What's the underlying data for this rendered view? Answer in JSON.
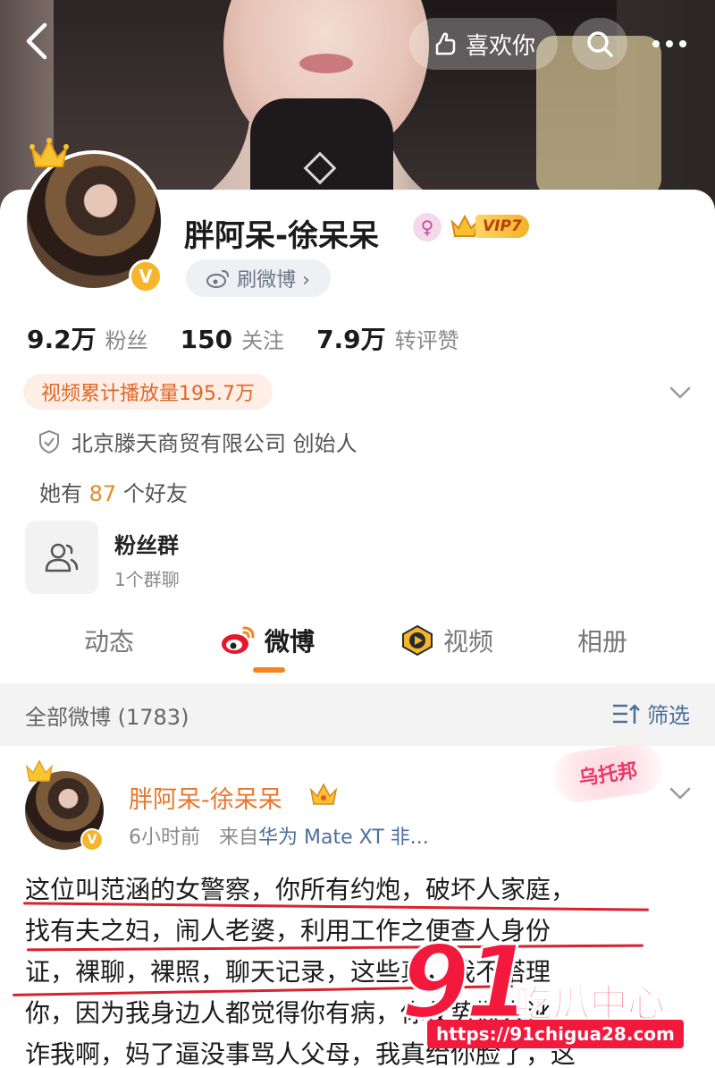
{
  "header": {
    "like_label": "喜欢你"
  },
  "profile": {
    "name": "胖阿呆-徐呆呆",
    "vip_label": "VIP7",
    "weibo_pill_label": "刷微博 ›",
    "stats": [
      {
        "num": "9.2万",
        "label": "粉丝"
      },
      {
        "num": "150",
        "label": "关注"
      },
      {
        "num": "7.9万",
        "label": "转评赞"
      }
    ],
    "video_badge": "视频累计播放量195.7万",
    "company": "北京滕天商贸有限公司 创始人",
    "friends_prefix": "她有",
    "friends_count": "87",
    "friends_suffix": "个好友",
    "fan_group": {
      "title": "粉丝群",
      "subtitle": "1个群聊"
    }
  },
  "tabs": [
    {
      "label": "动态",
      "icon": "none"
    },
    {
      "label": "微博",
      "icon": "weibo-icon"
    },
    {
      "label": "视频",
      "icon": "video-icon"
    },
    {
      "label": "相册",
      "icon": "none"
    }
  ],
  "feed": {
    "count_label": "全部微博 (1783)",
    "filter_label": "筛选"
  },
  "post": {
    "author": "胖阿呆-徐呆呆",
    "time": "6小时前",
    "source_prefix": "来自",
    "source": "华为 Mate XT 非...",
    "sticker": "乌托邦",
    "lines": [
      "这位叫范涵的女警察，你所有约炮，破坏人家庭，",
      "找有夫之妇，闹人老婆，利用工作之便查人身份",
      "证，裸聊，裸照，聊天记录，这些真，我不搭理",
      "你，因为我身边人都觉得你有病，你仗势欺人讹",
      "诈我啊，妈了逼没事骂人父母，我真给你脸了，这"
    ]
  },
  "watermark": {
    "number": "91",
    "text": "吃瓜中心",
    "url": "https://91chigua28.com"
  },
  "colors": {
    "accent_orange": "#f58420",
    "name_orange": "#e9762b",
    "link_blue": "#4d6f9c",
    "watermark_red": "#f3193d"
  }
}
